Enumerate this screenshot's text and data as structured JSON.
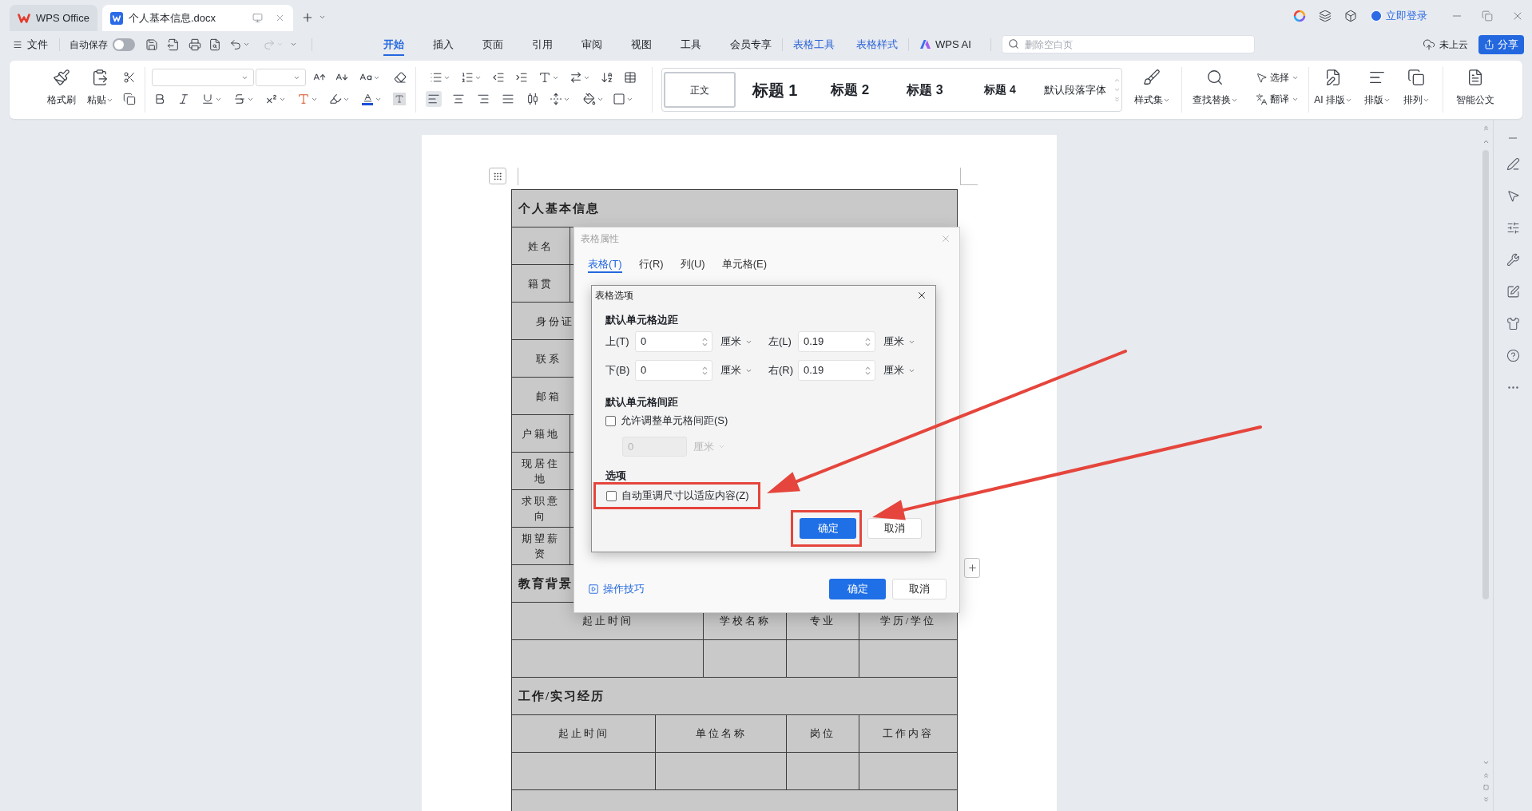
{
  "title_bar": {
    "tabs": [
      {
        "label": "WPS Office",
        "kind": "home",
        "selected": false
      },
      {
        "label": "个人基本信息.docx",
        "kind": "document",
        "selected": true
      }
    ],
    "login": "立即登录"
  },
  "menu_bar": {
    "file": "文件",
    "autosave": {
      "label": "自动保存",
      "on": false
    },
    "tabs": [
      {
        "label": "开始",
        "kind": "standard",
        "selected": true
      },
      {
        "label": "插入",
        "kind": "standard",
        "selected": false
      },
      {
        "label": "页面",
        "kind": "standard",
        "selected": false
      },
      {
        "label": "引用",
        "kind": "standard",
        "selected": false
      },
      {
        "label": "审阅",
        "kind": "standard",
        "selected": false
      },
      {
        "label": "视图",
        "kind": "standard",
        "selected": false
      },
      {
        "label": "工具",
        "kind": "standard",
        "selected": false
      },
      {
        "label": "会员专享",
        "kind": "standard",
        "selected": false
      },
      {
        "label": "表格工具",
        "kind": "contextual",
        "selected": false
      },
      {
        "label": "表格样式",
        "kind": "contextual",
        "selected": false
      },
      {
        "label": "WPS AI",
        "kind": "ai",
        "selected": false
      }
    ],
    "search": {
      "placeholder": "删除空白页"
    },
    "cloud_status": "未上云",
    "share": "分享"
  },
  "ribbon": {
    "clipboard": [
      {
        "label": "格式刷",
        "kind": "format-painter",
        "dropdown": false
      },
      {
        "label": "粘贴",
        "kind": "paste",
        "dropdown": true
      }
    ],
    "alignment": [
      {
        "kind": "left",
        "selected": true
      },
      {
        "kind": "center",
        "selected": false
      },
      {
        "kind": "right",
        "selected": false
      },
      {
        "kind": "justify",
        "selected": false
      },
      {
        "kind": "distributed",
        "selected": false
      }
    ],
    "styles": [
      {
        "label": "正文",
        "kind": "body",
        "selected": true
      },
      {
        "label": "标题 1",
        "kind": "heading-1",
        "selected": false
      },
      {
        "label": "标题 2",
        "kind": "heading-2",
        "selected": false
      },
      {
        "label": "标题 3",
        "kind": "heading-3",
        "selected": false
      },
      {
        "label": "标题 4",
        "kind": "heading-4",
        "selected": false
      },
      {
        "label": "默认段落字体",
        "kind": "default-font",
        "selected": false
      }
    ],
    "style_tools": [
      {
        "label": "样式集",
        "kind": "style-set",
        "dropdown": true
      },
      {
        "label": "查找替换",
        "kind": "find-replace",
        "dropdown": true
      }
    ],
    "quick_tools": [
      {
        "label": "选择",
        "kind": "select",
        "dropdown": true
      },
      {
        "label": "翻译",
        "kind": "translate",
        "dropdown": true
      }
    ],
    "layout_tools": [
      {
        "label": "AI 排版",
        "kind": "ai-layout",
        "dropdown": true
      },
      {
        "label": "排版",
        "kind": "typeset",
        "dropdown": true
      },
      {
        "label": "排列",
        "kind": "arrange",
        "dropdown": true
      },
      {
        "label": "智能公文",
        "kind": "smart-document",
        "dropdown": false
      }
    ]
  },
  "document": {
    "sections": [
      {
        "kind": "form",
        "title": "个人基本信息",
        "rows": [
          {
            "label": "姓名",
            "kind": "narrow"
          },
          {
            "label": "籍贯",
            "kind": "narrow"
          },
          {
            "label": "身份证",
            "kind": "wide"
          },
          {
            "label": "联系",
            "kind": "wide"
          },
          {
            "label": "邮箱",
            "kind": "wide"
          },
          {
            "label": "户籍地",
            "kind": "narrow"
          },
          {
            "label": "现居住地",
            "kind": "narrow"
          },
          {
            "label": "求职意向",
            "kind": "narrow"
          },
          {
            "label": "期望薪资",
            "kind": "narrow"
          }
        ]
      },
      {
        "kind": "grid",
        "title": "教育背景",
        "columns": [
          "起止时间",
          "学校名称",
          "专业",
          "学历/学位"
        ]
      },
      {
        "kind": "grid",
        "title": "工作/实习经历",
        "columns": [
          "起止时间",
          "单位名称",
          "岗位",
          "工作内容"
        ]
      }
    ]
  },
  "table_properties_dialog": {
    "title": "表格属性",
    "tabs": [
      {
        "label": "表格(T)",
        "selected": true
      },
      {
        "label": "行(R)",
        "selected": false
      },
      {
        "label": "列(U)",
        "selected": false
      },
      {
        "label": "单元格(E)",
        "selected": false
      }
    ],
    "tips_link": "操作技巧",
    "buttons": [
      {
        "label": "确定",
        "kind": "primary"
      },
      {
        "label": "取消",
        "kind": "secondary"
      }
    ]
  },
  "table_options_dialog": {
    "title": "表格选项",
    "margins": {
      "heading": "默认单元格边距",
      "fields": [
        {
          "label": "上(T)",
          "value": "0",
          "unit": "厘米"
        },
        {
          "label": "左(L)",
          "value": "0.19",
          "unit": "厘米"
        },
        {
          "label": "下(B)",
          "value": "0",
          "unit": "厘米"
        },
        {
          "label": "右(R)",
          "value": "0.19",
          "unit": "厘米"
        }
      ]
    },
    "spacing": {
      "heading": "默认单元格间距",
      "checkbox": {
        "label": "允许调整单元格间距(S)",
        "checked": false
      },
      "field": {
        "value": "0",
        "unit": "厘米",
        "disabled": true
      }
    },
    "options": {
      "heading": "选项",
      "checkbox": {
        "label": "自动重调尺寸以适应内容(Z)",
        "checked": false,
        "highlighted": true
      }
    },
    "buttons": [
      {
        "label": "确定",
        "kind": "primary",
        "highlighted": true
      },
      {
        "label": "取消",
        "kind": "secondary",
        "highlighted": false
      }
    ]
  }
}
